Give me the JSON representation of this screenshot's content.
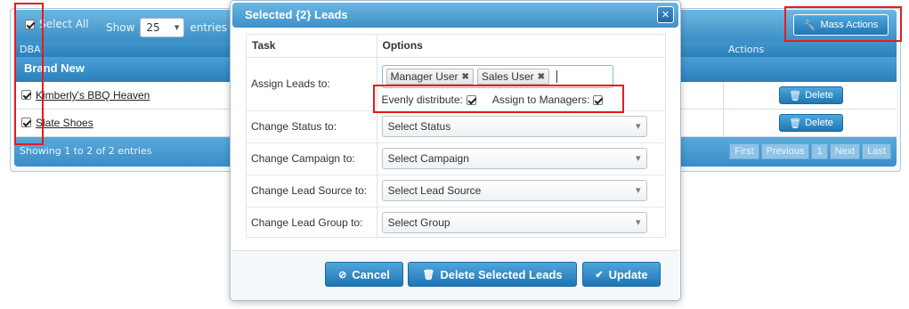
{
  "background": {
    "select_all_label": "Select All",
    "show_label": "Show",
    "entries_value": "25",
    "entries_label": "entries",
    "columns": {
      "dba": "DBA",
      "actions": "Actions"
    },
    "group_label": "Brand New",
    "rows": [
      {
        "name": "Kimberly's BBQ Heaven",
        "delete_label": "Delete"
      },
      {
        "name": "Slate Shoes",
        "delete_label": "Delete"
      }
    ],
    "footer_info": "Showing 1 to 2 of 2 entries",
    "pager": [
      "First",
      "Previous",
      "1",
      "Next",
      "Last"
    ],
    "mass_actions_label": "Mass Actions"
  },
  "modal": {
    "title": "Selected {2} Leads",
    "headers": {
      "task": "Task",
      "options": "Options"
    },
    "assign_label": "Assign Leads to:",
    "assigned_users": [
      "Manager User",
      "Sales User"
    ],
    "evenly_label": "Evenly distribute:",
    "managers_label": "Assign to Managers:",
    "fields": [
      {
        "label": "Change Status to:",
        "placeholder": "Select Status"
      },
      {
        "label": "Change Campaign to:",
        "placeholder": "Select Campaign"
      },
      {
        "label": "Change Lead Source to:",
        "placeholder": "Select Lead Source"
      },
      {
        "label": "Change Lead Group to:",
        "placeholder": "Select Group"
      }
    ],
    "buttons": {
      "cancel": "Cancel",
      "delete": "Delete Selected Leads",
      "update": "Update"
    }
  },
  "colors": {
    "accent": "#2f86c2",
    "highlight": "#e51c1c"
  }
}
